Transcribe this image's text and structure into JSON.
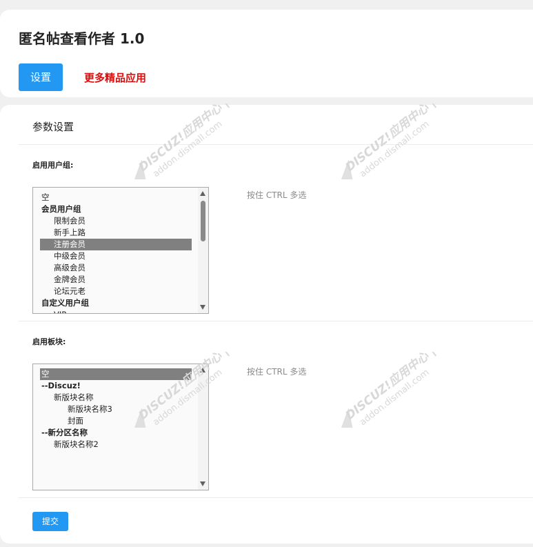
{
  "header": {
    "title": "匿名帖查看作者 1.0",
    "settings_button": "设置",
    "more_apps_link": "更多精品应用"
  },
  "form": {
    "section_title": "参数设置",
    "user_groups": {
      "label": "启用用户组:",
      "hint": "按住 CTRL 多选",
      "options": [
        {
          "label": "空",
          "kind": "option",
          "indent": 0,
          "selected": false
        },
        {
          "label": "会员用户组",
          "kind": "group",
          "indent": 0,
          "selected": false
        },
        {
          "label": "限制会员",
          "kind": "option",
          "indent": 1,
          "selected": false
        },
        {
          "label": "新手上路",
          "kind": "option",
          "indent": 1,
          "selected": false
        },
        {
          "label": "注册会员",
          "kind": "option",
          "indent": 1,
          "selected": true
        },
        {
          "label": "中级会员",
          "kind": "option",
          "indent": 1,
          "selected": false
        },
        {
          "label": "高级会员",
          "kind": "option",
          "indent": 1,
          "selected": false
        },
        {
          "label": "金牌会员",
          "kind": "option",
          "indent": 1,
          "selected": false
        },
        {
          "label": "论坛元老",
          "kind": "option",
          "indent": 1,
          "selected": false
        },
        {
          "label": "自定义用户组",
          "kind": "group",
          "indent": 0,
          "selected": false
        },
        {
          "label": "VIP",
          "kind": "option",
          "indent": 1,
          "selected": false
        }
      ]
    },
    "forums": {
      "label": "启用板块:",
      "hint": "按住 CTRL 多选",
      "options": [
        {
          "label": "空",
          "kind": "option",
          "indent": 0,
          "selected": true
        },
        {
          "label": "--Discuz!",
          "kind": "group",
          "indent": 0,
          "selected": false
        },
        {
          "label": "新版块名称",
          "kind": "option",
          "indent": 1,
          "selected": false
        },
        {
          "label": "新版块名称3",
          "kind": "option",
          "indent": 2,
          "selected": false
        },
        {
          "label": "封面",
          "kind": "option",
          "indent": 2,
          "selected": false
        },
        {
          "label": "--新分区名称",
          "kind": "group",
          "indent": 0,
          "selected": false
        },
        {
          "label": "新版块名称2",
          "kind": "option",
          "indent": 1,
          "selected": false
        }
      ]
    },
    "submit_button": "提交"
  },
  "watermark": {
    "line1": "DISCUZ!应用中心 | 贰道",
    "line2": "addon.dismall.com"
  }
}
